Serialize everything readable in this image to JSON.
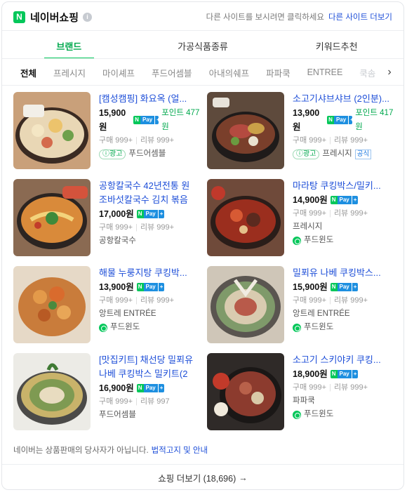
{
  "header": {
    "logo_letter": "N",
    "title": "네이버쇼핑",
    "info_icon": "i",
    "notice_text": "다른 사이트를 보시려면 클릭하세요",
    "other_sites_link": "다른 사이트 더보기"
  },
  "tabs": [
    {
      "label": "브랜드",
      "active": true
    },
    {
      "label": "가공식품종류",
      "active": false
    },
    {
      "label": "키워드추천",
      "active": false
    }
  ],
  "filters": [
    "전체",
    "프레시지",
    "마이셰프",
    "푸드어셈블",
    "아내의쉐프",
    "파파쿡",
    "ENTREE",
    "쿡솜"
  ],
  "filters_next_icon": "›",
  "products": [
    {
      "name_lines": [
        "[캠성캠핑] 화요옥 (얼..."
      ],
      "price": "15,900원",
      "npay": true,
      "points": "포인트 477원",
      "purchases": "구매 999+",
      "reviews": "리뷰 999+",
      "ad": "ⓘ광고",
      "seller": "푸드어셈블",
      "official": "",
      "store_icon": false
    },
    {
      "name_lines": [
        "소고기샤브샤브 (2인분)..."
      ],
      "price": "13,900원",
      "npay": true,
      "points": "포인트 417원",
      "purchases": "구매 999+",
      "reviews": "리뷰 999+",
      "ad": "ⓘ광고",
      "seller": "프레시지",
      "official": "공식",
      "store_icon": false
    },
    {
      "name_lines": [
        "공항칼국수 42년전통 원",
        "조바섯칼국수 김치 볶음"
      ],
      "price": "17,000원",
      "npay": true,
      "points": "",
      "purchases": "구매 999+",
      "reviews": "리뷰 999+",
      "ad": "",
      "seller": "공항칼국수",
      "official": "",
      "store_icon": false
    },
    {
      "name_lines": [
        "마라탕 쿠킹박스/밀키..."
      ],
      "price": "14,900원",
      "npay": true,
      "points": "",
      "purchases": "구매 999+",
      "reviews": "리뷰 999+",
      "ad": "",
      "seller": "프레시지",
      "official": "",
      "store_icon": false,
      "extra_seller": "푸드윈도"
    },
    {
      "name_lines": [
        "해물 누룽지탕 쿠킹박..."
      ],
      "price": "13,900원",
      "npay": true,
      "points": "",
      "purchases": "구매 999+",
      "reviews": "리뷰 999+",
      "ad": "",
      "seller": "앙트레 ENTRÉE",
      "official": "",
      "store_icon": false,
      "extra_seller": "푸드윈도"
    },
    {
      "name_lines": [
        "밀푀유 나베 쿠킹박스..."
      ],
      "price": "15,900원",
      "npay": true,
      "points": "",
      "purchases": "구매 999+",
      "reviews": "리뷰 999+",
      "ad": "",
      "seller": "앙트레 ENTRÉE",
      "official": "",
      "store_icon": false,
      "extra_seller": "푸드윈도"
    },
    {
      "name_lines": [
        "[맛집키트] 채선당 밀푀유",
        "나베 쿠킹박스 밀키트(2"
      ],
      "price": "16,900원",
      "npay": true,
      "points": "",
      "purchases": "구매 999+",
      "reviews": "리뷰 997",
      "ad": "",
      "seller": "푸드어셈블",
      "official": "",
      "store_icon": false
    },
    {
      "name_lines": [
        "소고기 스키야키 쿠킹..."
      ],
      "price": "18,900원",
      "npay": true,
      "points": "",
      "purchases": "구매 999+",
      "reviews": "리뷰 999+",
      "ad": "",
      "seller": "파파쿡",
      "official": "",
      "store_icon": false,
      "extra_seller": "푸드윈도"
    }
  ],
  "npay_badge": {
    "n": "N",
    "pay": "Pay",
    "plus": "+"
  },
  "footer": {
    "notice": "네이버는 상품판매의 당사자가 아닙니다.",
    "notice_link": "법적고지 및 안내",
    "more_label": "쇼핑 더보기 (18,696)",
    "more_arrow": "→"
  },
  "colors": {
    "accent": "#03c75a",
    "link": "#1d4ed8",
    "npay_blue": "#1d8fe0"
  }
}
